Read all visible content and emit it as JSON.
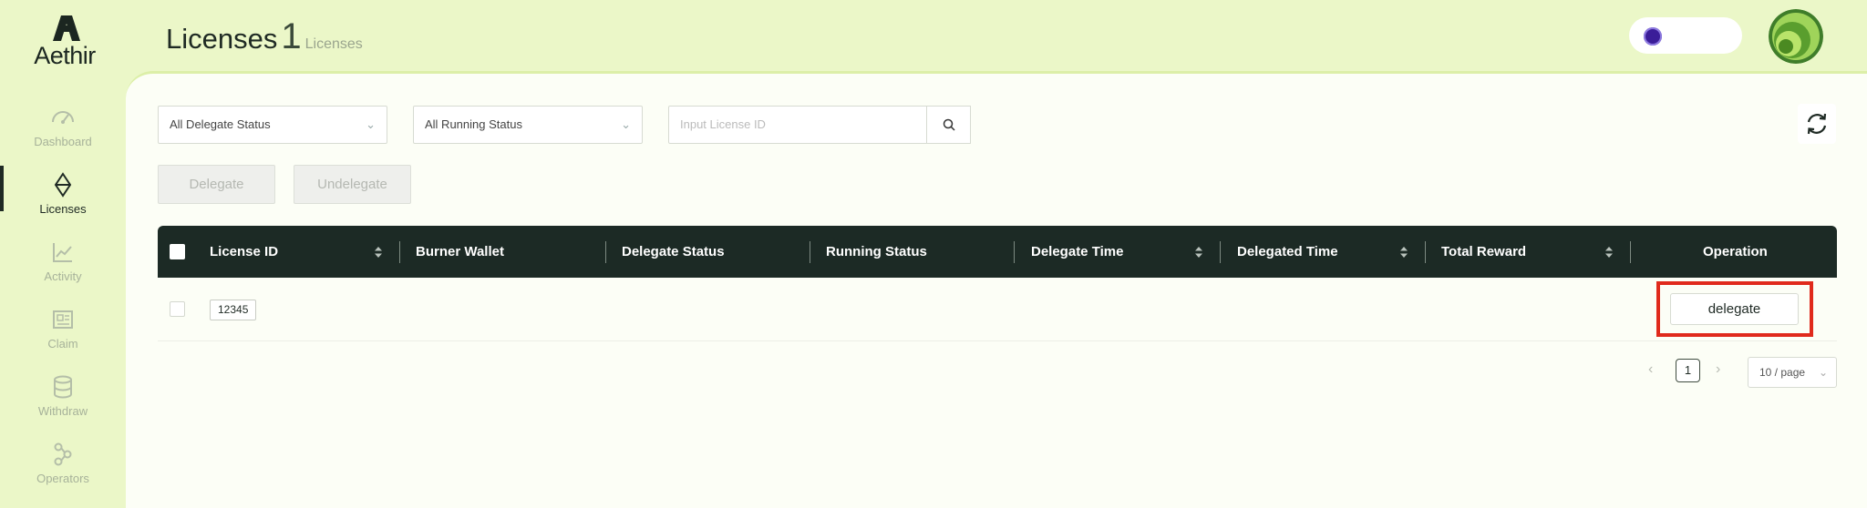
{
  "brand": {
    "name": "Aethir"
  },
  "sidebar": {
    "items": [
      {
        "label": "Dashboard",
        "icon": "gauge-icon",
        "active": false
      },
      {
        "label": "Licenses",
        "icon": "diamond-icon",
        "active": true
      },
      {
        "label": "Activity",
        "icon": "chart-line-icon",
        "active": false
      },
      {
        "label": "Claim",
        "icon": "receipt-icon",
        "active": false
      },
      {
        "label": "Withdraw",
        "icon": "database-icon",
        "active": false
      },
      {
        "label": "Operators",
        "icon": "nodes-icon",
        "active": false
      }
    ]
  },
  "header": {
    "title": "Licenses",
    "count": "1",
    "count_label": "Licenses"
  },
  "filters": {
    "delegate_status": "All Delegate Status",
    "running_status": "All Running Status",
    "search_placeholder": "Input License ID"
  },
  "actions": {
    "delegate": "Delegate",
    "undelegate": "Undelegate"
  },
  "table": {
    "columns": [
      "License ID",
      "Burner Wallet",
      "Delegate Status",
      "Running Status",
      "Delegate Time",
      "Delegated Time",
      "Total Reward",
      "Operation"
    ],
    "rows": [
      {
        "license_id": "12345",
        "operation": "delegate"
      }
    ]
  },
  "pagination": {
    "current_page": "1",
    "page_size": "10 / page"
  },
  "colors": {
    "background": "#ebf7c8",
    "table_header": "#1c2a25",
    "highlight": "#e02a1c"
  }
}
